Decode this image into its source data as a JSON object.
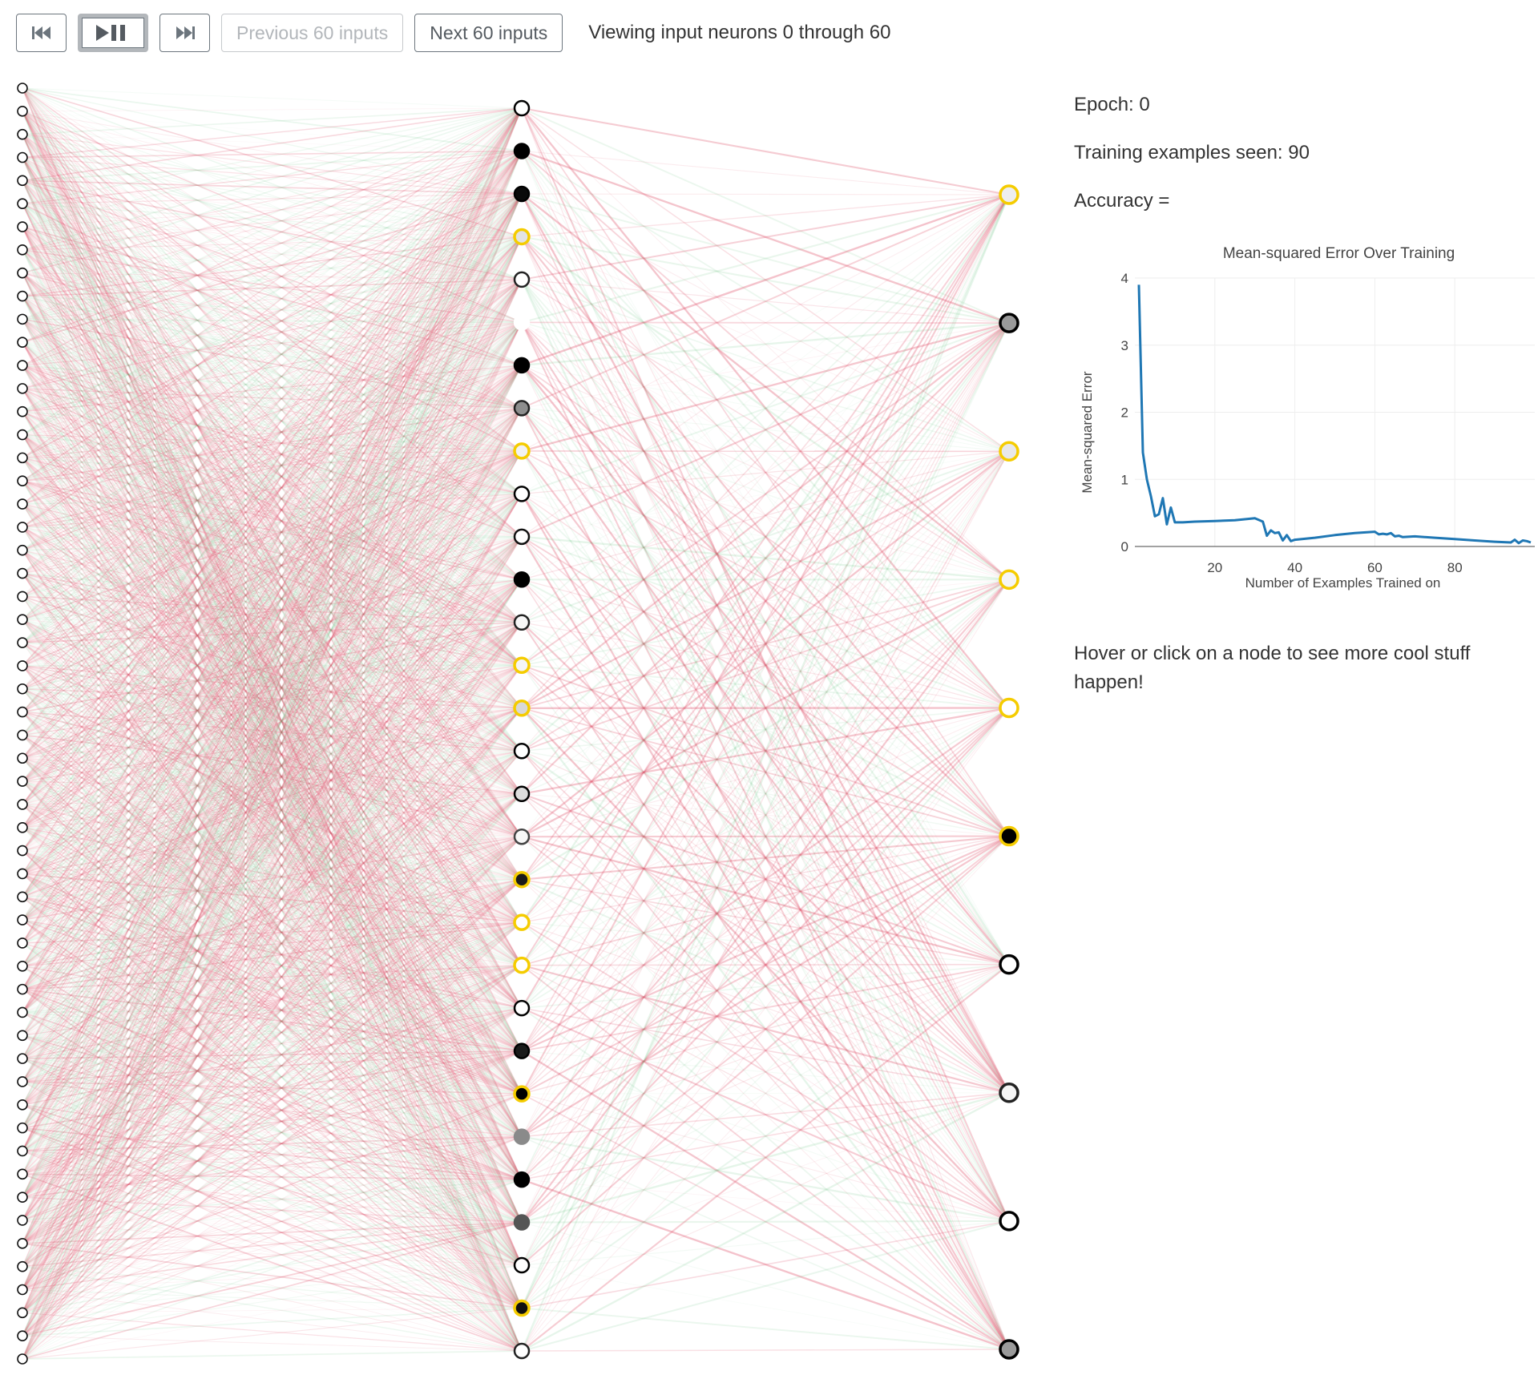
{
  "toolbar": {
    "skip_back_icon": "skip-back-icon",
    "play_pause_icon": "play-pause-icon",
    "skip_forward_icon": "skip-forward-icon",
    "prev_label": "Previous 60 inputs",
    "next_label": "Next 60 inputs",
    "viewing_text": "Viewing input neurons 0 through 60"
  },
  "stats": {
    "epoch": "Epoch: 0",
    "examples_seen": "Training examples seen: 90",
    "accuracy": "Accuracy ="
  },
  "hint": "Hover or click on a node to see more cool stuff happen!",
  "colors": {
    "positive_weight": "#e0576f",
    "negative_weight": "#5cbf78",
    "highlight_ring": "#f5cc00",
    "line_series": "#1f77b4"
  },
  "network": {
    "input_count": 56,
    "hidden_nodes": [
      {
        "fill": "#ffffff",
        "ring": "#000000"
      },
      {
        "fill": "#000000",
        "ring": "#000000"
      },
      {
        "fill": "#0a0a0a",
        "ring": "#000000"
      },
      {
        "fill": "#e3e3e3",
        "ring": "#f5cc00"
      },
      {
        "fill": "#ffffff",
        "ring": "#222222"
      },
      {
        "fill": "#ffffff",
        "ring": "#ffffff"
      },
      {
        "fill": "#000000",
        "ring": "#000000"
      },
      {
        "fill": "#8e8e8e",
        "ring": "#222222"
      },
      {
        "fill": "#f2f2f2",
        "ring": "#f5cc00"
      },
      {
        "fill": "#ffffff",
        "ring": "#000000"
      },
      {
        "fill": "#ffffff",
        "ring": "#111111"
      },
      {
        "fill": "#000000",
        "ring": "#000000"
      },
      {
        "fill": "#f7f7f7",
        "ring": "#222222"
      },
      {
        "fill": "#f5f5f5",
        "ring": "#f5cc00"
      },
      {
        "fill": "#d8d8d8",
        "ring": "#f5cc00"
      },
      {
        "fill": "#ffffff",
        "ring": "#000000"
      },
      {
        "fill": "#dddddd",
        "ring": "#000000"
      },
      {
        "fill": "#f7f7f7",
        "ring": "#444444"
      },
      {
        "fill": "#1a1a1a",
        "ring": "#f5cc00"
      },
      {
        "fill": "#ffffff",
        "ring": "#f5cc00"
      },
      {
        "fill": "#ffffff",
        "ring": "#f5cc00"
      },
      {
        "fill": "#ffffff",
        "ring": "#000000"
      },
      {
        "fill": "#1a1a1a",
        "ring": "#000000"
      },
      {
        "fill": "#000000",
        "ring": "#f5cc00"
      },
      {
        "fill": "#8a8a8a",
        "ring": "#8a8a8a"
      },
      {
        "fill": "#000000",
        "ring": "#000000"
      },
      {
        "fill": "#555555",
        "ring": "#555555"
      },
      {
        "fill": "#ffffff",
        "ring": "#000000"
      },
      {
        "fill": "#111111",
        "ring": "#f5cc00"
      },
      {
        "fill": "#ffffff",
        "ring": "#222222"
      }
    ],
    "output_nodes": [
      {
        "fill": "#eeeeee",
        "ring": "#f5cc00"
      },
      {
        "fill": "#9a9a9a",
        "ring": "#000000"
      },
      {
        "fill": "#e8e8e8",
        "ring": "#f5cc00"
      },
      {
        "fill": "#f5f5f5",
        "ring": "#f5cc00"
      },
      {
        "fill": "#ffffff",
        "ring": "#f5cc00"
      },
      {
        "fill": "#000000",
        "ring": "#f5cc00"
      },
      {
        "fill": "#ffffff",
        "ring": "#000000"
      },
      {
        "fill": "#f5f5f5",
        "ring": "#222222"
      },
      {
        "fill": "#ffffff",
        "ring": "#000000"
      },
      {
        "fill": "#9a9a9a",
        "ring": "#000000"
      }
    ]
  },
  "chart_data": {
    "type": "line",
    "title": "Mean-squared Error Over Training",
    "xlabel": "Number of Examples Trained on",
    "ylabel": "Mean-squared Error",
    "xlim": [
      0,
      100
    ],
    "ylim": [
      0,
      4
    ],
    "x_ticks": [
      20,
      40,
      60,
      80
    ],
    "y_ticks": [
      0,
      1,
      2,
      3,
      4
    ],
    "grid": true,
    "series": [
      {
        "x": [
          1,
          2,
          3,
          4,
          5,
          6,
          7,
          8,
          9,
          10,
          12,
          15,
          20,
          25,
          30,
          32,
          33,
          34,
          35,
          36,
          37,
          38,
          39,
          40,
          45,
          50,
          55,
          60,
          61,
          62,
          63,
          64,
          65,
          66,
          67,
          70,
          75,
          80,
          85,
          90,
          94,
          95,
          96,
          97,
          98,
          99
        ],
        "y": [
          3.9,
          1.4,
          1.0,
          0.75,
          0.45,
          0.48,
          0.72,
          0.33,
          0.58,
          0.36,
          0.36,
          0.37,
          0.38,
          0.39,
          0.42,
          0.37,
          0.16,
          0.24,
          0.2,
          0.21,
          0.09,
          0.17,
          0.08,
          0.1,
          0.13,
          0.17,
          0.2,
          0.22,
          0.18,
          0.19,
          0.18,
          0.2,
          0.15,
          0.16,
          0.14,
          0.15,
          0.13,
          0.11,
          0.09,
          0.07,
          0.06,
          0.1,
          0.05,
          0.09,
          0.08,
          0.06
        ]
      }
    ]
  }
}
